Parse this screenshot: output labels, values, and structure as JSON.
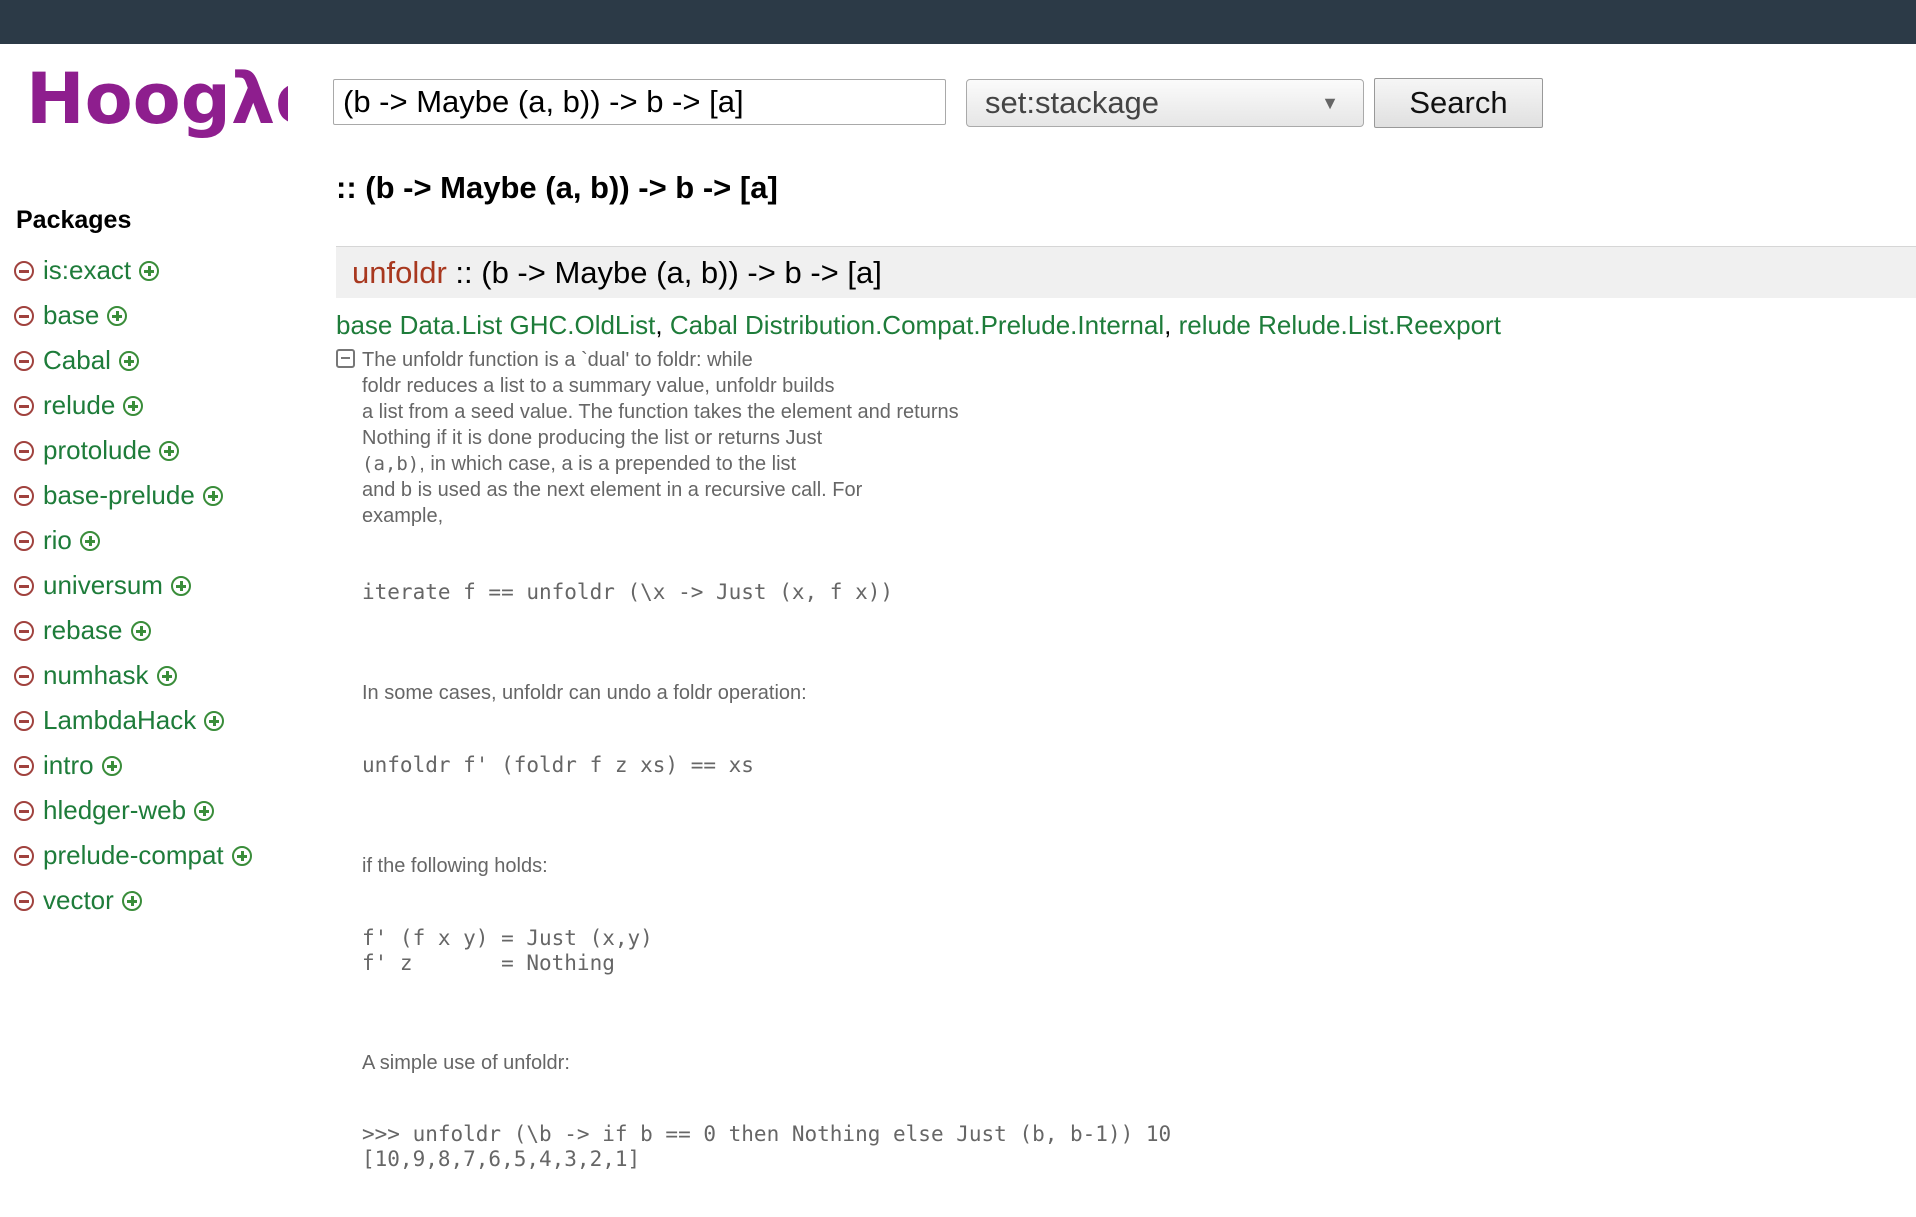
{
  "logo": {
    "text": "Hoogλe"
  },
  "search": {
    "value": "(b -> Maybe (a, b)) -> b -> [a]",
    "scope": "set:stackage",
    "button_label": "Search"
  },
  "query_title": ":: (b -> Maybe (a, b)) -> b -> [a]",
  "sidebar": {
    "heading": "Packages",
    "packages": [
      "is:exact",
      "base",
      "Cabal",
      "relude",
      "protolude",
      "base-prelude",
      "rio",
      "universum",
      "rebase",
      "numhask",
      "LambdaHack",
      "intro",
      "hledger-web",
      "prelude-compat",
      "vector"
    ]
  },
  "result": {
    "name": "unfoldr",
    "signature": ":: (b -> Maybe (a, b)) -> b -> [a]",
    "packages": {
      "p1_pkg": "base",
      "p1_m1": "Data.List",
      "p1_m2": "GHC.OldList",
      "p2_pkg": "Cabal",
      "p2_m1": "Distribution.Compat.Prelude.Internal",
      "p3_pkg": "relude",
      "p3_m1": "Relude.List.Reexport",
      "separator": ","
    },
    "doc": {
      "l1": "The unfoldr function is a `dual' to foldr: while",
      "l2": "foldr reduces a list to a summary value, unfoldr builds",
      "l3": "a list from a seed value. The function takes the element and returns",
      "l4": "Nothing if it is done producing the list or returns Just",
      "l5_code": "(a,b)",
      "l5_text": ", in which case, a is a prepended to the list",
      "l6": "and b is used as the next element in a recursive call. For",
      "l7": "example,",
      "code1": "iterate f == unfoldr (\\x -> Just (x, f x))",
      "p2": "In some cases, unfoldr can undo a foldr operation:",
      "code2": "unfoldr f' (foldr f z xs) == xs",
      "p3": "if the following holds:",
      "code3_l1": "f' (f x y) = Just (x,y)",
      "code3_l2": "f' z       = Nothing",
      "p4": "A simple use of unfoldr:",
      "code4_l1": ">>> unfoldr (\\b -> if b == 0 then Nothing else Just (b, b-1)) 10",
      "code4_l2": "[10,9,8,7,6,5,4,3,2,1]"
    }
  }
}
